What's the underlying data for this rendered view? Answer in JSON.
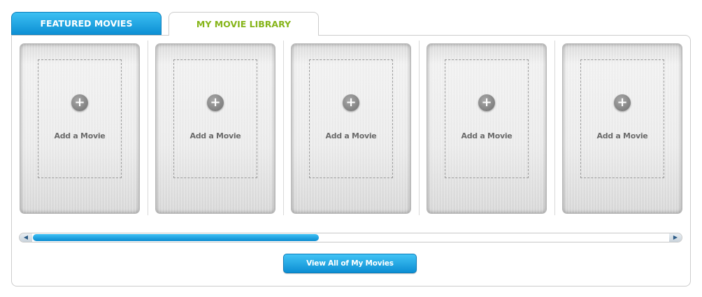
{
  "tabs": {
    "featured_label": "FEATURED MOVIES",
    "library_label": "MY MOVIE LIBRARY",
    "active": "MY MOVIE LIBRARY"
  },
  "slots": [
    {
      "label": "Add a Movie",
      "icon": "plus-icon"
    },
    {
      "label": "Add a Movie",
      "icon": "plus-icon"
    },
    {
      "label": "Add a Movie",
      "icon": "plus-icon"
    },
    {
      "label": "Add a Movie",
      "icon": "plus-icon"
    },
    {
      "label": "Add a Movie",
      "icon": "plus-icon"
    }
  ],
  "scrollbar": {
    "thumb_fraction": 0.45,
    "left_icon": "arrow-left-icon",
    "right_icon": "arrow-right-icon"
  },
  "view_all_label": "View All of My Movies",
  "colors": {
    "accent_blue": "#1aa6e6",
    "library_tab_text": "#86b51a",
    "tab_text": "#ffffff"
  }
}
